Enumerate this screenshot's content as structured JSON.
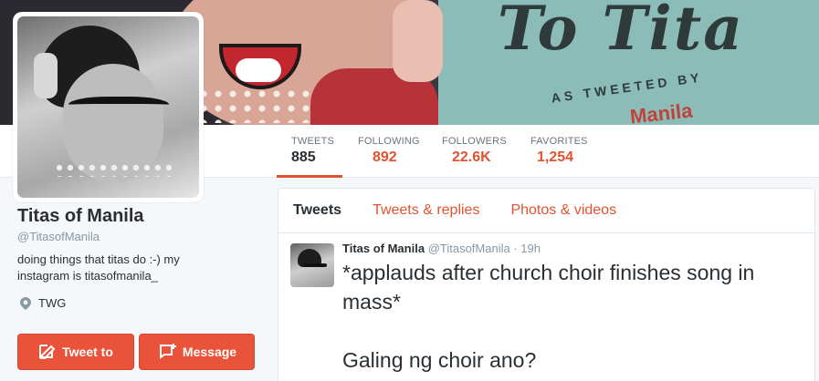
{
  "banner": {
    "title": "To Tita",
    "subtitle": "AS TWEETED BY",
    "handle_fragment": "Manila"
  },
  "nav": {
    "stats": [
      {
        "label": "TWEETS",
        "value": "885"
      },
      {
        "label": "FOLLOWING",
        "value": "892"
      },
      {
        "label": "FOLLOWERS",
        "value": "22.6K"
      },
      {
        "label": "FAVORITES",
        "value": "1,254"
      }
    ]
  },
  "profile": {
    "name": "Titas of Manila",
    "handle": "@TitasofManila",
    "bio": "doing things that titas do :-) my instagram is titasofmanila_",
    "location": "TWG",
    "tweet_to_label": "Tweet to",
    "message_label": "Message",
    "icons": {
      "location": "map-pin-icon",
      "tweet_to": "compose-icon",
      "message": "new-message-icon"
    }
  },
  "timeline": {
    "tabs": [
      "Tweets",
      "Tweets & replies",
      "Photos & videos"
    ],
    "tweet": {
      "name": "Titas of Manila",
      "handle": "@TitasofManila",
      "time": "· 19h",
      "text_line1": "*applauds after church choir finishes song in mass*",
      "text_line2": "Galing ng choir ano?"
    }
  },
  "colors": {
    "accent": "#e0532f",
    "text": "#292f33",
    "muted": "#8899a6",
    "background": "#f5f8fa"
  }
}
